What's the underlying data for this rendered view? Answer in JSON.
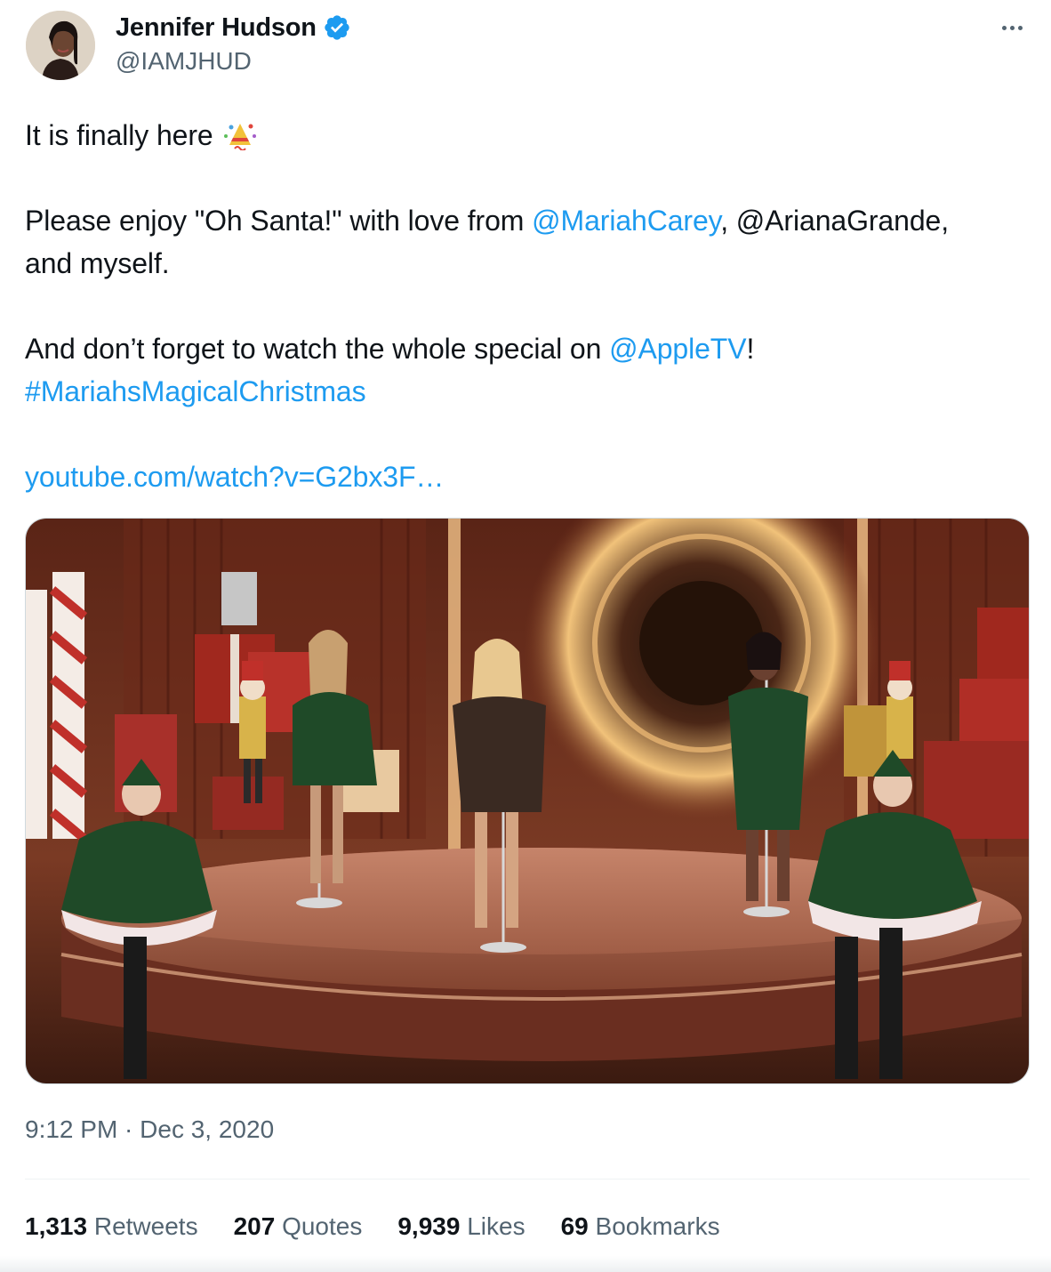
{
  "author": {
    "display_name": "Jennifer Hudson",
    "handle": "@IAMJHUD",
    "verified": true,
    "avatar_icon": "avatar-photo",
    "verified_icon": "verified-badge-icon",
    "badge_color": "#1d9bf0"
  },
  "menu": {
    "icon": "more-options-icon"
  },
  "tweet": {
    "line1": "It is finally here",
    "line1_emoji": "party-popper-emoji",
    "line2_prefix": "Please enjoy \"Oh Santa!\" with love from ",
    "mention1": "@MariahCarey",
    "line2_suffix": ", @ArianaGrande,",
    "line3": "and myself.",
    "line4_prefix": "And don’t forget to watch the whole special on ",
    "mention2": "@AppleTV",
    "line4_suffix": "!",
    "hashtag": "#MariahsMagicalChristmas",
    "url": "youtube.com/watch?v=G2bx3F…"
  },
  "media": {
    "type": "video-thumbnail",
    "description_icon": "video-media"
  },
  "timestamp": "9:12 PM · Dec 3, 2020",
  "stats": [
    {
      "num": "1,313",
      "label": "Retweets"
    },
    {
      "num": "207",
      "label": "Quotes"
    },
    {
      "num": "9,939",
      "label": "Likes"
    },
    {
      "num": "69",
      "label": "Bookmarks"
    }
  ],
  "colors": {
    "text": "#0f1419",
    "secondary": "#536471",
    "link": "#1d9bf0",
    "border": "#cfd9de"
  }
}
